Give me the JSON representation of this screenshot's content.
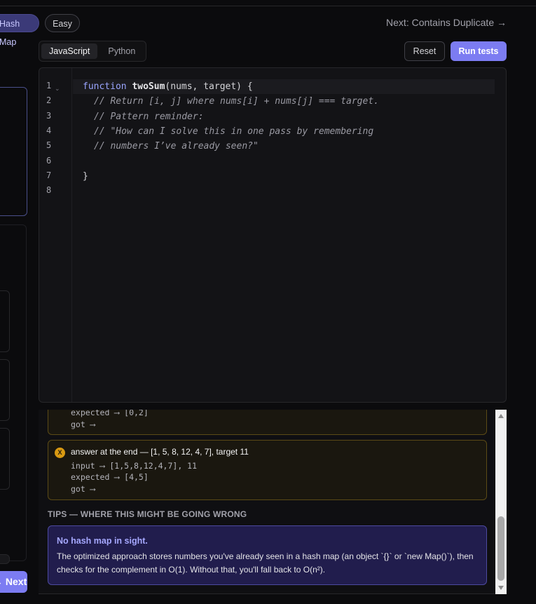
{
  "header": {
    "chip_pattern": "Hash Map",
    "chip_difficulty": "Easy",
    "next_label": "Next: Contains Duplicate →"
  },
  "language_tabs": [
    {
      "label": "JavaScript",
      "active": true
    },
    {
      "label": "Python",
      "active": false
    }
  ],
  "toolbar": {
    "reset_label": "Reset",
    "run_label": "Run tests"
  },
  "editor": {
    "line_numbers": [
      "1",
      "2",
      "3",
      "4",
      "5",
      "6",
      "7",
      "8"
    ],
    "fold_marker": "⌄",
    "code": {
      "kw_function": "function",
      "fn_name": "twoSum",
      "params": "(nums, target) {",
      "c2": "// Return [i, j] where nums[i] + nums[j] === target.",
      "c3": "// Pattern reminder:",
      "c4": "// \"How can I solve this in one pass by remembering",
      "c5": "// numbers I’ve already seen?\"",
      "close": "}"
    }
  },
  "results": {
    "case1": {
      "expected": "expected ⟶ [0,2]",
      "got": "got ⟶"
    },
    "case2": {
      "badge": "X",
      "title": "answer at the end — [1, 5, 8, 12, 4, 7], target 11",
      "input": "input ⟶ [1,5,8,12,4,7], 11",
      "expected": "expected ⟶ [4,5]",
      "got": "got ⟶"
    },
    "tips_header": "TIPS — WHERE THIS MIGHT BE GOING WRONG",
    "tip": {
      "title": "No hash map in sight.",
      "body": "The optimized approach stores numbers you've already seen in a hash map (an object `{}` or `new Map()`), then checks for the complement in O(1). Without that, you'll fall back to O(n²)."
    }
  },
  "left_panel": {
    "next_button": "Next →"
  },
  "colors": {
    "accent": "#7c7cf2",
    "warning": "#d99a12",
    "tip_bg": "#211d4d"
  }
}
